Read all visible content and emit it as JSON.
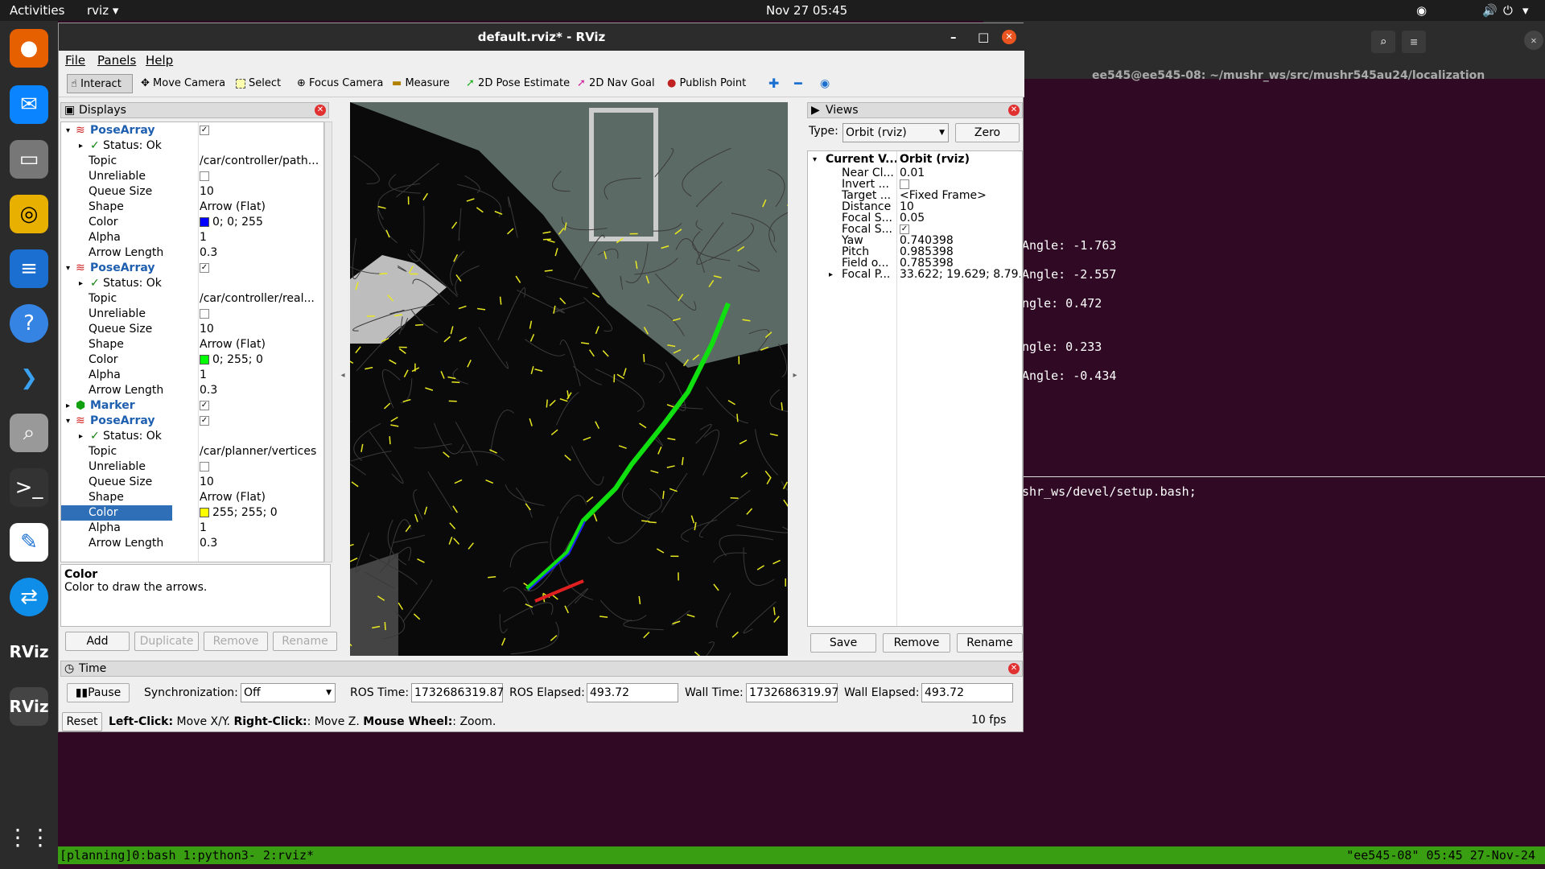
{
  "topbar": {
    "activities": "Activities",
    "app": "rviz ▾",
    "clock": "Nov 27  05:45"
  },
  "terminal": {
    "title": "ee545@ee545-08: ~/mushr_ws/src/mushr545au24/localization",
    "lines": [
      "Angle: -1.763",
      "Angle: -2.557",
      "ngle: 0.472",
      "ngle: 0.233",
      "Angle: -0.434",
      "shr_ws/devel/setup.bash;"
    ],
    "tmux_left": "[planning]0:bash  1:python3- 2:rviz*",
    "tmux_right": "\"ee545-08\" 05:45 27-Nov-24"
  },
  "window": {
    "title": "default.rviz* - RViz"
  },
  "menu": {
    "file": "File",
    "panels": "Panels",
    "help": "Help"
  },
  "toolbar": {
    "interact": "Interact",
    "move_camera": "Move Camera",
    "select": "Select",
    "focus_camera": "Focus Camera",
    "measure": "Measure",
    "pose_estimate": "2D Pose Estimate",
    "nav_goal": "2D Nav Goal",
    "publish_point": "Publish Point"
  },
  "displays": {
    "title": "Displays",
    "rows": [
      {
        "k": "PoseArray",
        "v": "",
        "type": "header"
      },
      {
        "k": "Status: Ok",
        "v": "",
        "type": "status"
      },
      {
        "k": "Topic",
        "v": "/car/controller/path..."
      },
      {
        "k": "Unreliable",
        "v": "",
        "type": "cb"
      },
      {
        "k": "Queue Size",
        "v": "10"
      },
      {
        "k": "Shape",
        "v": "Arrow (Flat)"
      },
      {
        "k": "Color",
        "v": "0; 0; 255",
        "color": "#0000ff"
      },
      {
        "k": "Alpha",
        "v": "1"
      },
      {
        "k": "Arrow Length",
        "v": "0.3"
      },
      {
        "k": "PoseArray",
        "v": "",
        "type": "header"
      },
      {
        "k": "Status: Ok",
        "v": "",
        "type": "status"
      },
      {
        "k": "Topic",
        "v": "/car/controller/real..."
      },
      {
        "k": "Unreliable",
        "v": "",
        "type": "cb"
      },
      {
        "k": "Queue Size",
        "v": "10"
      },
      {
        "k": "Shape",
        "v": "Arrow (Flat)"
      },
      {
        "k": "Color",
        "v": "0; 255; 0",
        "color": "#00ff00"
      },
      {
        "k": "Alpha",
        "v": "1"
      },
      {
        "k": "Arrow Length",
        "v": "0.3"
      },
      {
        "k": "Marker",
        "v": "",
        "type": "marker"
      },
      {
        "k": "PoseArray",
        "v": "",
        "type": "header"
      },
      {
        "k": "Status: Ok",
        "v": "",
        "type": "status"
      },
      {
        "k": "Topic",
        "v": "/car/planner/vertices"
      },
      {
        "k": "Unreliable",
        "v": "",
        "type": "cb"
      },
      {
        "k": "Queue Size",
        "v": "10"
      },
      {
        "k": "Shape",
        "v": "Arrow (Flat)"
      },
      {
        "k": "Color",
        "v": "255; 255; 0",
        "color": "#ffff00",
        "selected": true
      },
      {
        "k": "Alpha",
        "v": "1"
      },
      {
        "k": "Arrow Length",
        "v": "0.3"
      }
    ],
    "desc_title": "Color",
    "desc_text": "Color to draw the arrows.",
    "add": "Add",
    "duplicate": "Duplicate",
    "remove": "Remove",
    "rename": "Rename"
  },
  "views": {
    "title": "Views",
    "type_label": "Type:",
    "type_value": "Orbit (rviz)",
    "zero": "Zero",
    "current_k": "Current V...",
    "current_v": "Orbit (rviz)",
    "rows": [
      {
        "k": "Near Cl...",
        "v": "0.01"
      },
      {
        "k": "Invert ...",
        "v": "",
        "type": "cb"
      },
      {
        "k": "Target ...",
        "v": "<Fixed Frame>"
      },
      {
        "k": "Distance",
        "v": "10"
      },
      {
        "k": "Focal S...",
        "v": "0.05"
      },
      {
        "k": "Focal S...",
        "v": "✓",
        "type": "cbchk"
      },
      {
        "k": "Yaw",
        "v": "0.740398"
      },
      {
        "k": "Pitch",
        "v": "0.985398"
      },
      {
        "k": "Field o...",
        "v": "0.785398"
      },
      {
        "k": "Focal P...",
        "v": "33.622; 19.629; 8.79..."
      }
    ],
    "save": "Save",
    "remove": "Remove",
    "rename": "Rename"
  },
  "time": {
    "title": "Time",
    "pause": "Pause",
    "sync_label": "Synchronization:",
    "sync_value": "Off",
    "ros_time_label": "ROS Time:",
    "ros_time": "1732686319.87",
    "ros_elapsed_label": "ROS Elapsed:",
    "ros_elapsed": "493.72",
    "wall_time_label": "Wall Time:",
    "wall_time": "1732686319.97",
    "wall_elapsed_label": "Wall Elapsed:",
    "wall_elapsed": "493.72",
    "reset": "Reset",
    "help_b1": "Left-Click:",
    "help_t1": " Move X/Y. ",
    "help_b2": "Right-Click:",
    "help_t2": ": Move Z. ",
    "help_b3": "Mouse Wheel:",
    "help_t3": ": Zoom.",
    "fps": "10 fps"
  }
}
